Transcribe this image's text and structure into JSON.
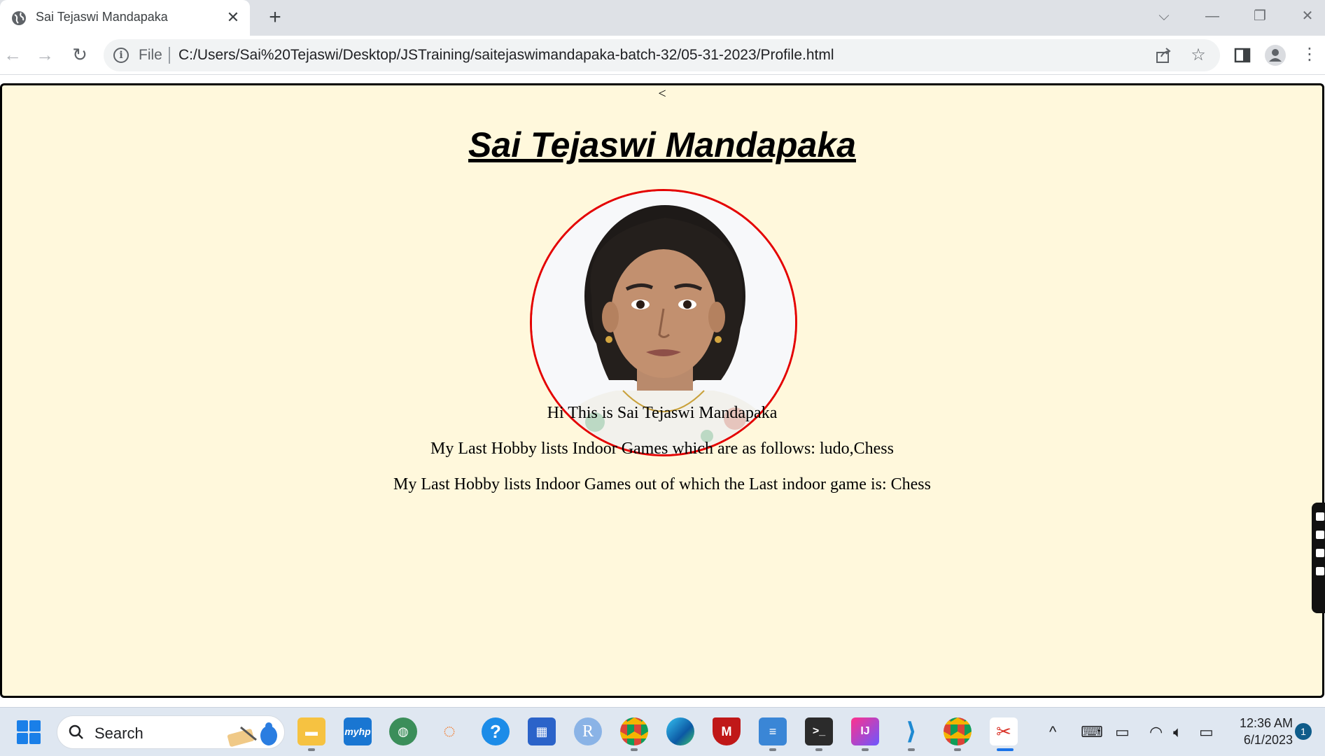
{
  "browser": {
    "tab_title": "Sai Tejaswi Mandapaka",
    "tab_close_glyph": "✕",
    "new_tab_glyph": "+",
    "file_label": "File",
    "url": "C:/Users/Sai%20Tejaswi/Desktop/JSTraining/saitejaswimandapaka-batch-32/05-31-2023/Profile.html"
  },
  "page": {
    "back_glyph": "<",
    "title": "Sai Tejaswi Mandapaka",
    "intro": "Hi This is Sai Tejaswi Mandapaka",
    "hobby_list": "My Last Hobby lists Indoor Games which are as follows: ludo,Chess",
    "last_game": "My Last Hobby lists Indoor Games out of which the Last indoor game is: Chess",
    "background_color": "#fff8dc",
    "avatar_border_color": "#e40000"
  },
  "taskbar": {
    "search_label": "Search",
    "time": "12:36 AM",
    "date": "6/1/2023",
    "notification_count": "1"
  }
}
